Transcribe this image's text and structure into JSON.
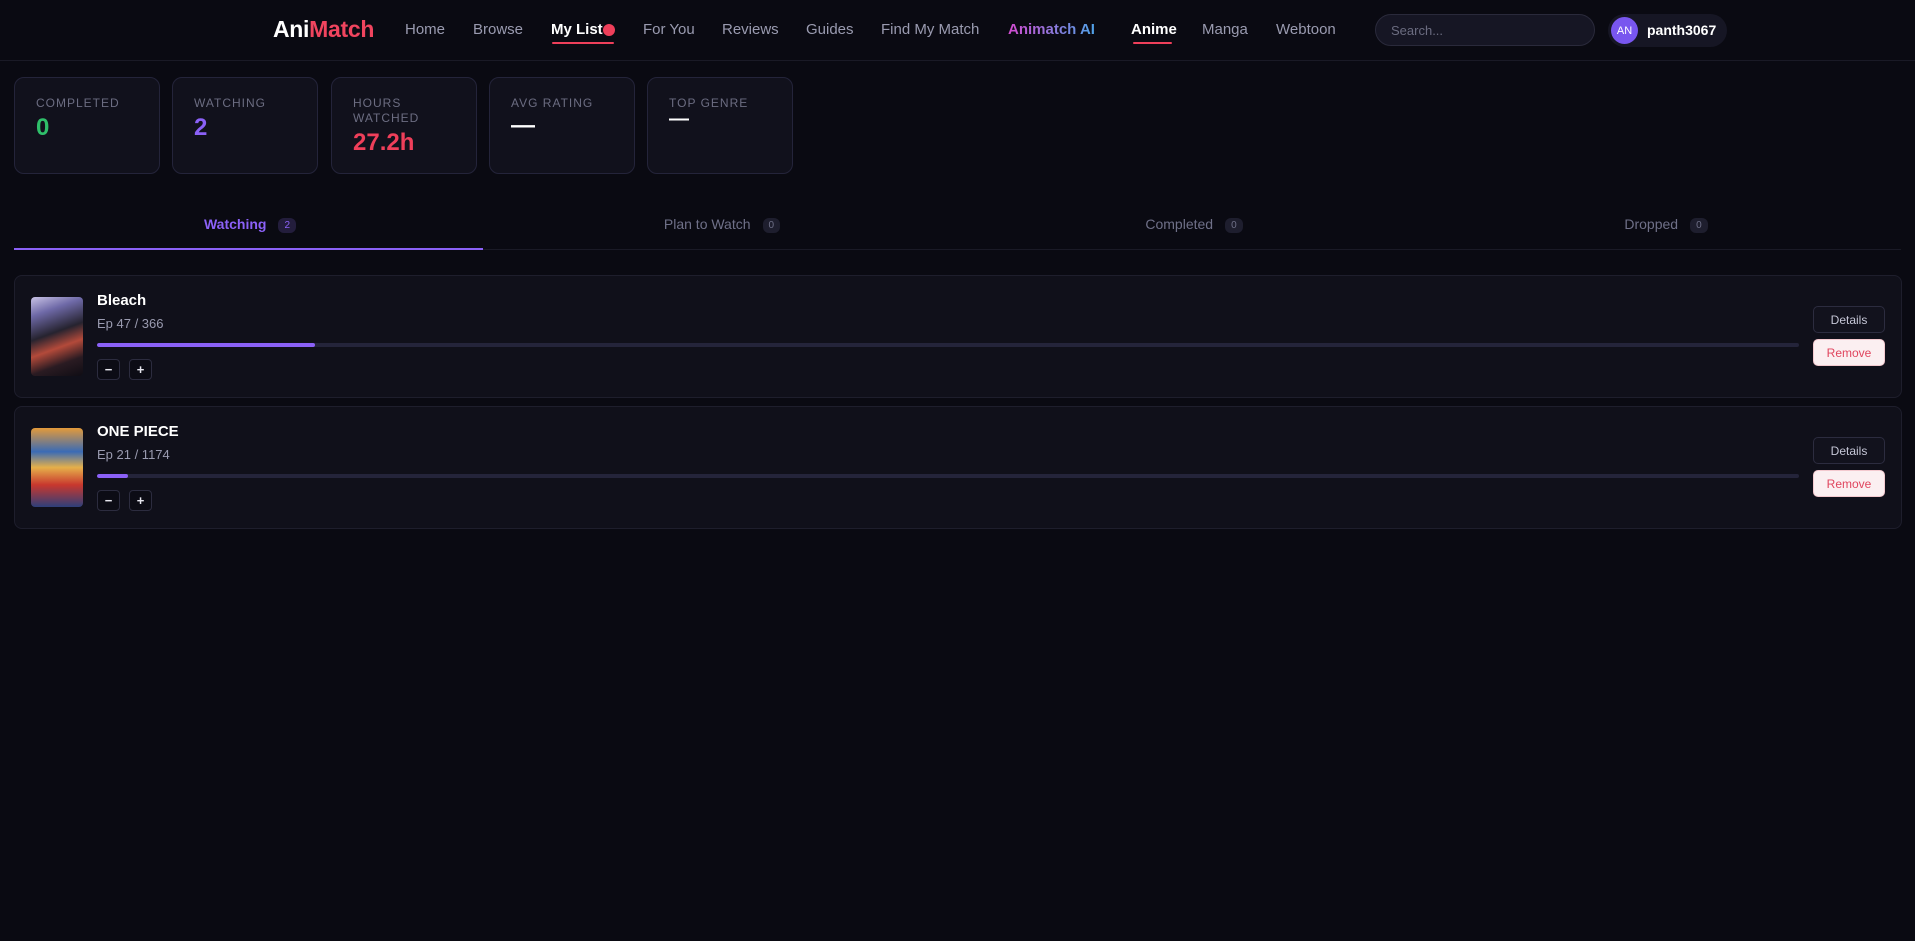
{
  "brand": {
    "part1": "Ani",
    "part2": "Match"
  },
  "nav": {
    "home": "Home",
    "browse": "Browse",
    "my_list": "My List",
    "for_you": "For You",
    "reviews": "Reviews",
    "guides": "Guides",
    "find_my_match": "Find My Match",
    "animatch_ai": "Animatch AI",
    "anime": "Anime",
    "manga": "Manga",
    "webtoon": "Webtoon"
  },
  "search": {
    "placeholder": "Search..."
  },
  "user": {
    "initials": "AN",
    "name": "panth3067"
  },
  "stats": [
    {
      "label": "Completed",
      "value": "0",
      "color": "#2fbf6a"
    },
    {
      "label": "Watching",
      "value": "2",
      "color": "#8b61f7"
    },
    {
      "label": "Hours Watched",
      "value": "27.2h",
      "color": "#ef3f5a"
    },
    {
      "label": "Avg Rating",
      "value": "—",
      "color": "#ffffff"
    },
    {
      "label": "Top Genre",
      "value": "—",
      "color": "#ffffff"
    }
  ],
  "tabs": [
    {
      "label": "Watching",
      "count": "2"
    },
    {
      "label": "Plan to Watch",
      "count": "0"
    },
    {
      "label": "Completed",
      "count": "0"
    },
    {
      "label": "Dropped",
      "count": "0"
    }
  ],
  "items": [
    {
      "title": "Bleach",
      "episodes": "Ep 47 / 366",
      "progress": 0.128,
      "decrement": "−",
      "increment": "+",
      "details": "Details",
      "remove": "Remove"
    },
    {
      "title": "ONE PIECE",
      "episodes": "Ep 21 / 1174",
      "progress": 0.018,
      "decrement": "−",
      "increment": "+",
      "details": "Details",
      "remove": "Remove"
    }
  ],
  "colors": {
    "accent": "#8b61f7",
    "brand": "#ef3f5a",
    "background": "#0a0a12"
  }
}
